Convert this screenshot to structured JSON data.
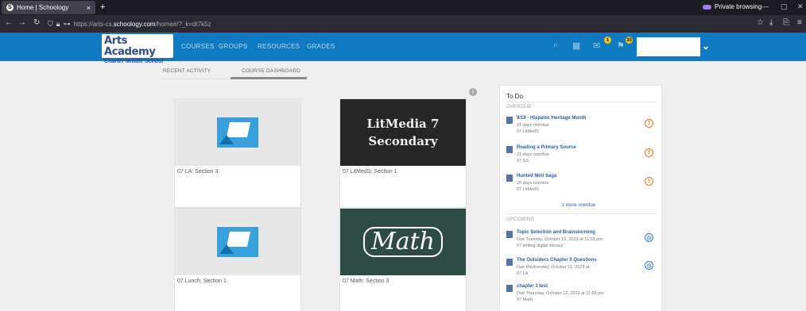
{
  "browser": {
    "tab_title": "Home | Schoology",
    "tab_icon": "S",
    "new_tab": "+",
    "close_tab": "×",
    "private_label": "Private browsing",
    "url_prefix": "https://arts-cs.",
    "url_domain": "schoology.com",
    "url_path": "/home#/?_k=dt7k5z"
  },
  "header": {
    "logo_line1": "Arts Academy",
    "logo_line2": "Charter Middle School",
    "nav": [
      "COURSES",
      "GROUPS",
      "RESOURCES",
      "GRADES"
    ],
    "badge_messages": "1",
    "badge_notifications": "30",
    "accent_color": "#0f7ac0"
  },
  "subtabs": {
    "recent": "RECENT ACTIVITY",
    "dashboard": "COURSE DASHBOARD"
  },
  "courses": [
    {
      "name": "07 LA: Section 3"
    },
    {
      "name": "07 LitMedS: Section 1",
      "image_text_1": "LitMedia 7",
      "image_text_2": "Secondary"
    },
    {
      "name": "07 Lunch: Section 1"
    },
    {
      "name": "07 Math: Section 3",
      "image_text": "Math"
    }
  ],
  "todo": {
    "title": "To Do",
    "overdue_label": "OVERDUE",
    "upcoming_label": "UPCOMING",
    "more_overdue": "1 more overdue",
    "overdue": [
      {
        "title": "9/19 - Hispanic Heritage Month",
        "line1": "21 days overdue",
        "line2": "07 LitMedS"
      },
      {
        "title": "Reading a Primary Source",
        "line1": "21 days overdue",
        "line2": "07 SS"
      },
      {
        "title": "Hunted Mini Saga",
        "line1": "20 days overdue",
        "line2": "07 LitMedS"
      }
    ],
    "upcoming": [
      {
        "title": "Topic Selection and Brainstorming",
        "line1": "Due Tuesday, October 10, 2023 at 11:59 pm",
        "line2": "07 writing digital literacy"
      },
      {
        "title": "The Outsiders Chapter 5 Questions",
        "line1": "Due Wednesday, October 11, 2023 at",
        "line2": "07 LA"
      },
      {
        "title": "chapter 1 test",
        "line1": "Due Thursday, October 12, 2023 at 11:59 pm",
        "line2": "07 Math"
      }
    ]
  }
}
